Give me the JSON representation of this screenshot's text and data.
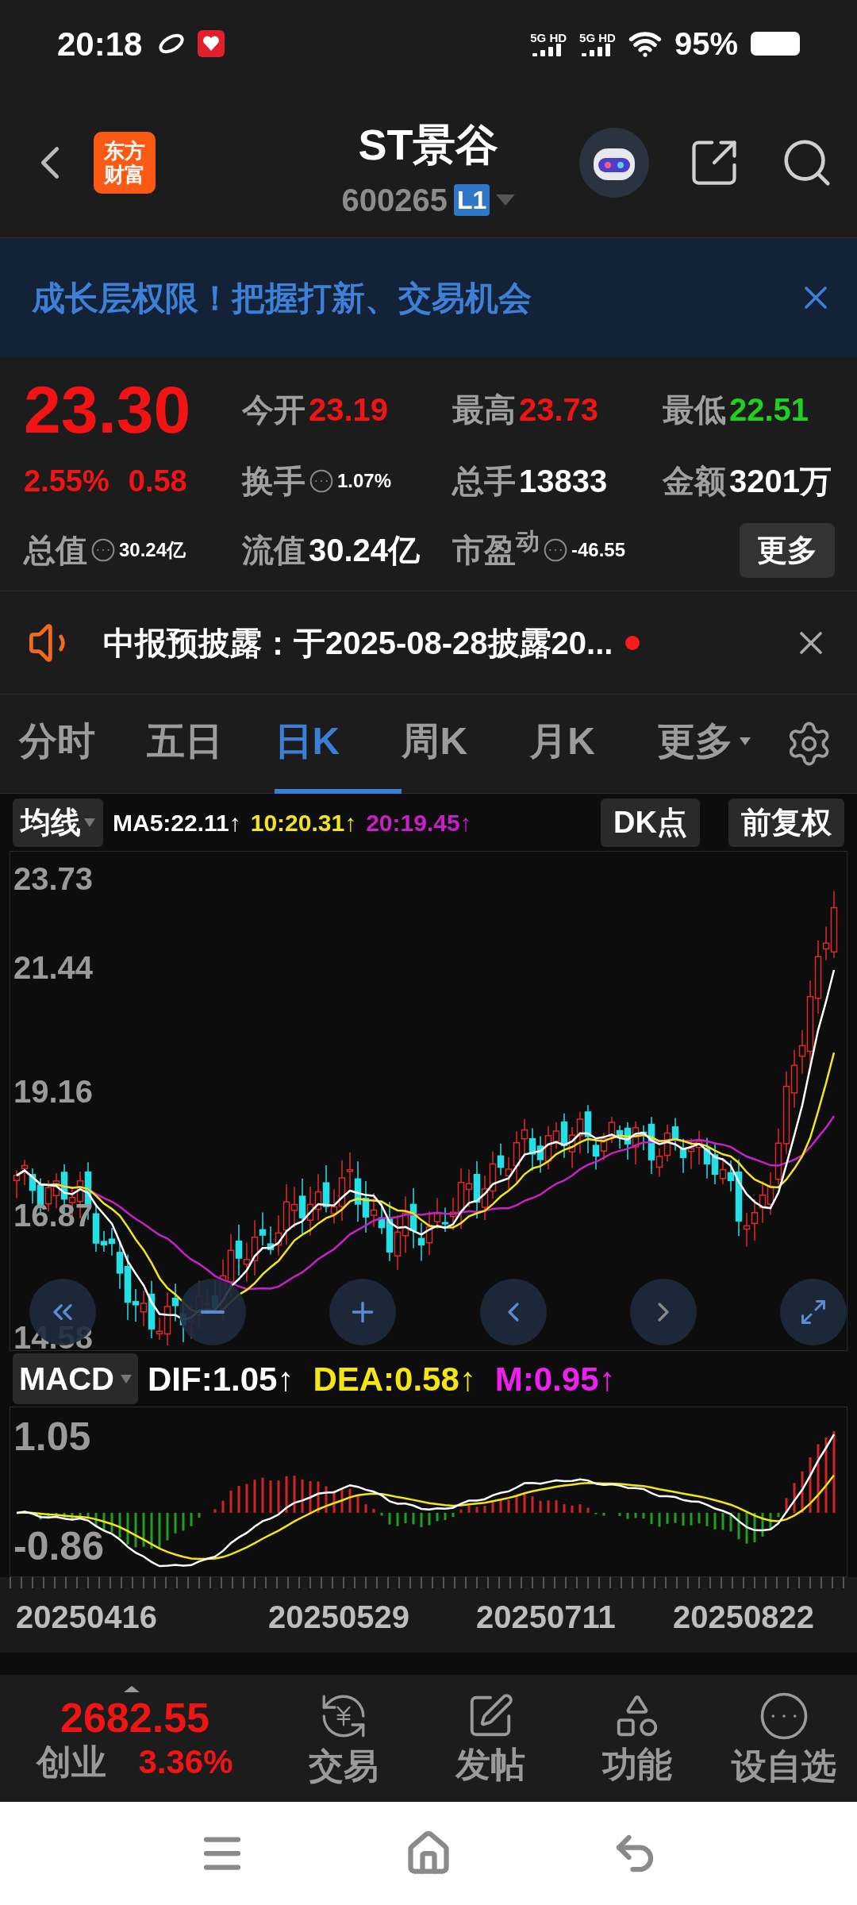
{
  "status_bar": {
    "time": "20:18",
    "networks": [
      "5G HD",
      "5G HD"
    ],
    "battery": "95%"
  },
  "header": {
    "logo_lines": [
      "东方",
      "财富"
    ],
    "title": "ST景谷",
    "code": "600265",
    "badge": "L1"
  },
  "banner": {
    "text": "成长层权限！把握打新、交易机会"
  },
  "quote": {
    "cells": [
      {
        "kind": "price",
        "value": "23.30",
        "color": "#f21414"
      },
      {
        "kind": "stat",
        "label": "今开",
        "value": "23.19",
        "color": "#f21414",
        "info": false
      },
      {
        "kind": "stat",
        "label": "最高",
        "value": "23.73",
        "color": "#f21414",
        "info": false
      },
      {
        "kind": "stat",
        "label": "最低",
        "value": "22.51",
        "color": "#1ed21e",
        "info": false
      },
      {
        "kind": "change",
        "values": [
          "2.55%",
          "0.58"
        ],
        "color": "#f21414"
      },
      {
        "kind": "stat",
        "label": "换手",
        "value": "1.07%",
        "color": "#ffffff",
        "info": true
      },
      {
        "kind": "stat",
        "label": "总手",
        "value": "13833",
        "color": "#ffffff",
        "info": false
      },
      {
        "kind": "stat",
        "label": "金额",
        "value": "3201万",
        "color": "#ffffff",
        "info": false
      },
      {
        "kind": "stat",
        "label": "总值",
        "value": "30.24亿",
        "color": "#ffffff",
        "info": true
      },
      {
        "kind": "stat",
        "label": "流值",
        "value": "30.24亿",
        "color": "#ffffff",
        "info": false
      },
      {
        "kind": "stat",
        "label": "市盈$^{动}$",
        "value": "-46.55",
        "color": "#ffffff",
        "info": true
      },
      {
        "kind": "button",
        "label": "更多"
      }
    ]
  },
  "notice": {
    "text": "中报预披露：于2025-08-28披露20...",
    "unread": true
  },
  "tabs": [
    {
      "label": "分时",
      "selected": false,
      "dropdown": false
    },
    {
      "label": "五日",
      "selected": false,
      "dropdown": false
    },
    {
      "label": "日K",
      "selected": true,
      "dropdown": false
    },
    {
      "label": "周K",
      "selected": false,
      "dropdown": false
    },
    {
      "label": "月K",
      "selected": false,
      "dropdown": false
    },
    {
      "label": "更多",
      "selected": false,
      "dropdown": true
    }
  ],
  "chart": {
    "selector": "均线",
    "ma_values": [
      {
        "text": "MA5:22.11↑",
        "color": "#ffffff"
      },
      {
        "text": "10:20.31↑",
        "color": "#f2e51c"
      },
      {
        "text": "20:19.45↑",
        "color": "#c81fc8"
      }
    ],
    "buttons": [
      "DK点",
      "前复权"
    ],
    "price_axis": [
      "23.73",
      "21.44",
      "19.16",
      "16.87",
      "14.58"
    ]
  },
  "macd": {
    "selector": "MACD",
    "values": [
      {
        "text": "DIF:1.05↑",
        "color": "#ffffff"
      },
      {
        "text": "DEA:0.58↑",
        "color": "#f5e60f"
      },
      {
        "text": "M:0.95↑",
        "color": "#f01ef0"
      }
    ],
    "axis": [
      "1.05",
      "-0.86"
    ],
    "dates": [
      "20250416",
      "20250529",
      "20250711",
      "20250822"
    ]
  },
  "bottom_bar": {
    "index_value": "2682.55",
    "index_name": "创业",
    "index_change": "3.36%",
    "color": "#f21414",
    "items": [
      {
        "kind": "trade",
        "label": "交易"
      },
      {
        "kind": "post",
        "label": "发帖"
      },
      {
        "kind": "functions",
        "label": "功能"
      },
      {
        "kind": "watchlist",
        "label": "设自选"
      }
    ]
  }
}
